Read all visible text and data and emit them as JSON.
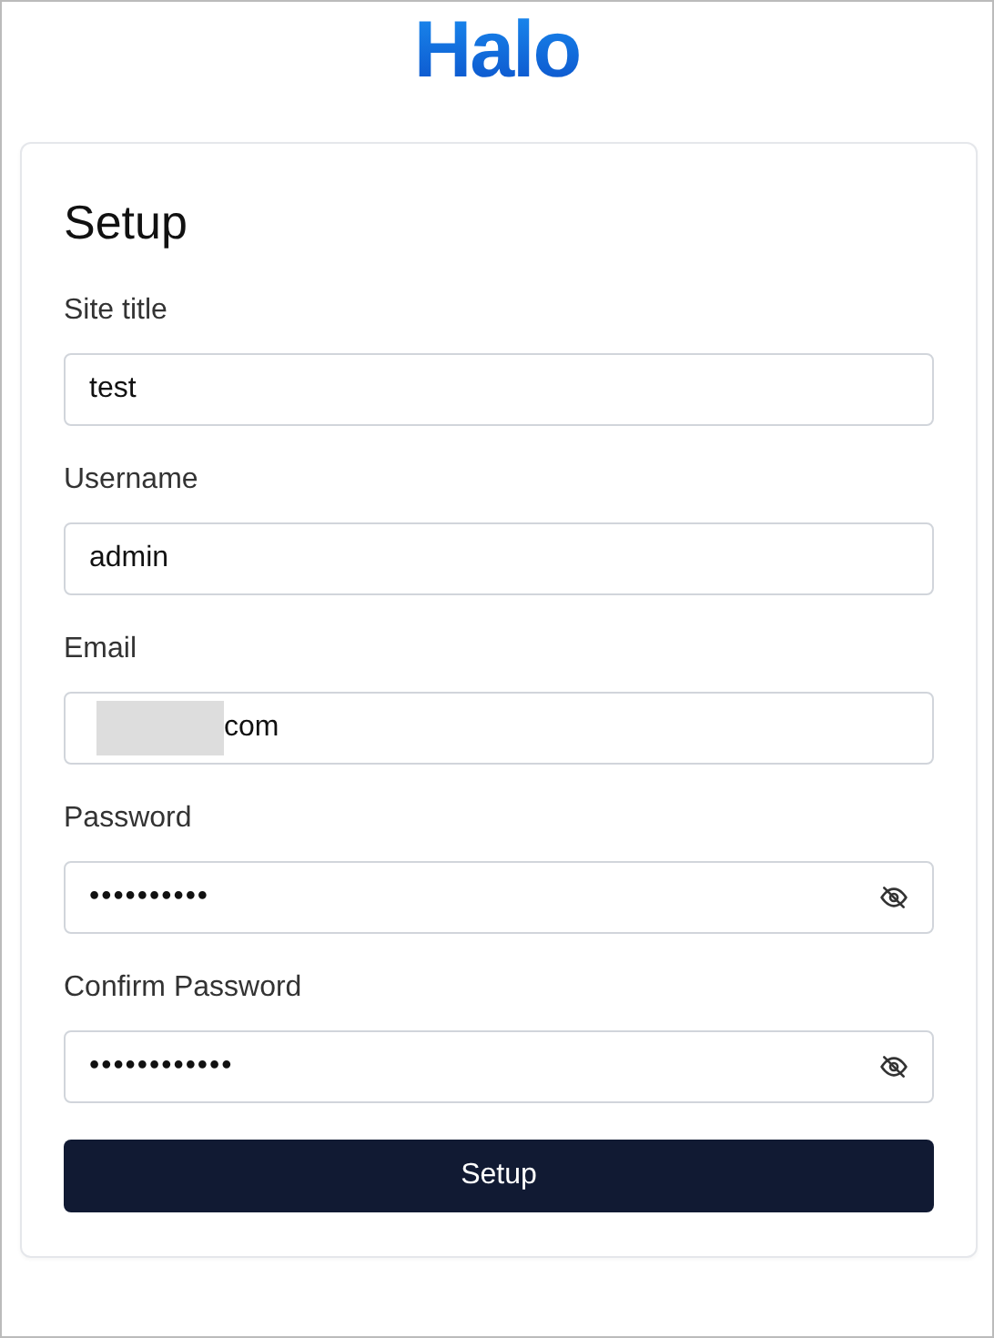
{
  "logo": "Halo",
  "form": {
    "title": "Setup",
    "fields": [
      {
        "label": "Site title",
        "kind": "text",
        "value": "test"
      },
      {
        "label": "Username",
        "kind": "text",
        "value": "admin"
      },
      {
        "label": "Email",
        "kind": "redacted",
        "value": "com"
      },
      {
        "label": "Password",
        "kind": "password",
        "value": "••••••••••"
      },
      {
        "label": "Confirm Password",
        "kind": "password",
        "value": "••••••••••••"
      }
    ],
    "submit": "Setup"
  }
}
